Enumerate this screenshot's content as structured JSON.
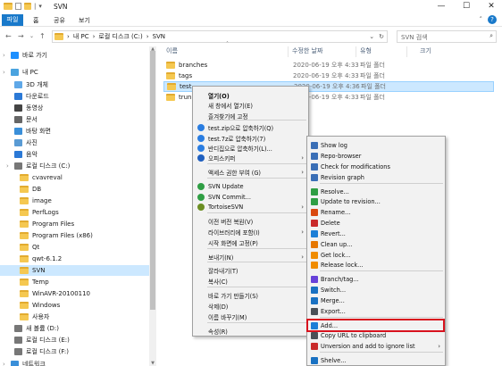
{
  "window": {
    "title": "SVN",
    "qat_sep": "|",
    "qat_arrow": "▾",
    "minimize": "—",
    "maximize": "☐",
    "close": "✕"
  },
  "ribbon": {
    "tabs": [
      "파일",
      "홈",
      "공유",
      "보기"
    ],
    "help_icon": "?",
    "collapse_icon": "˄"
  },
  "nav": {
    "back": "←",
    "forward": "→",
    "dropdown": "⌄",
    "up": "↑"
  },
  "address": {
    "parts": [
      "내 PC",
      "로컬 디스크 (C:)",
      "SVN"
    ],
    "sep": "›",
    "lead_sep": "›",
    "dropdown": "⌄",
    "refresh": "↻"
  },
  "search": {
    "placeholder": "SVN 검색",
    "icon": "⌕"
  },
  "sidebar": {
    "items": [
      {
        "label": "바로 가기",
        "icon": "star-icon",
        "color": "#1e90ff"
      },
      {
        "label": "내 PC",
        "icon": "pc-icon",
        "color": "#4aa3df"
      },
      {
        "label": "3D 개체",
        "icon": "cube-icon",
        "color": "#5fa8e8"
      },
      {
        "label": "다운로드",
        "icon": "download-icon",
        "color": "#2b79d6"
      },
      {
        "label": "동영상",
        "icon": "video-icon",
        "color": "#444"
      },
      {
        "label": "문서",
        "icon": "document-icon",
        "color": "#666"
      },
      {
        "label": "바탕 화면",
        "icon": "desktop-icon",
        "color": "#3a8fd9"
      },
      {
        "label": "사진",
        "icon": "picture-icon",
        "color": "#5a9bd4"
      },
      {
        "label": "음악",
        "icon": "music-icon",
        "color": "#2b79d6"
      },
      {
        "label": "로컬 디스크 (C:)",
        "icon": "drive-icon",
        "color": "#777"
      },
      {
        "label": "cvavreval",
        "icon": "folder-icon",
        "color": "#f5c851"
      },
      {
        "label": "DB",
        "icon": "folder-icon",
        "color": "#f5c851"
      },
      {
        "label": "image",
        "icon": "folder-icon",
        "color": "#f5c851"
      },
      {
        "label": "PerfLogs",
        "icon": "folder-icon",
        "color": "#f5c851"
      },
      {
        "label": "Program Files",
        "icon": "folder-icon",
        "color": "#f5c851"
      },
      {
        "label": "Program Files (x86)",
        "icon": "folder-icon",
        "color": "#f5c851"
      },
      {
        "label": "Qt",
        "icon": "folder-icon",
        "color": "#f5c851"
      },
      {
        "label": "qwt-6.1.2",
        "icon": "folder-icon",
        "color": "#f5c851"
      },
      {
        "label": "SVN",
        "icon": "folder-icon",
        "color": "#f5c851"
      },
      {
        "label": "Temp",
        "icon": "folder-icon",
        "color": "#f5c851"
      },
      {
        "label": "WinAVR-20100110",
        "icon": "folder-icon",
        "color": "#f5c851"
      },
      {
        "label": "Windows",
        "icon": "folder-icon",
        "color": "#f5c851"
      },
      {
        "label": "사용자",
        "icon": "folder-icon",
        "color": "#f5c851"
      },
      {
        "label": "새 볼륨 (D:)",
        "icon": "drive-icon",
        "color": "#777"
      },
      {
        "label": "로컬 디스크 (E:)",
        "icon": "drive-icon",
        "color": "#777"
      },
      {
        "label": "로컬 디스크 (F:)",
        "icon": "drive-icon",
        "color": "#777"
      },
      {
        "label": "네트워크",
        "icon": "network-icon",
        "color": "#3a8fd9"
      }
    ],
    "chevron": "›",
    "scroll_up": "▲",
    "scroll_down": "▼"
  },
  "columns": {
    "name": "이름",
    "date": "수정한 날짜",
    "type": "유형",
    "size": "크기",
    "sort": "˄"
  },
  "files": [
    {
      "name": "branches",
      "date": "2020-06-19 오후 4:33",
      "type": "파일 폴더"
    },
    {
      "name": "tags",
      "date": "2020-06-19 오후 4:33",
      "type": "파일 폴더"
    },
    {
      "name": "test",
      "date": "2020-06-19 오후 4:36",
      "type": "파일 폴더"
    },
    {
      "name": "trunk",
      "date": "2020-06-19 오후 4:33",
      "type": "파일 폴더"
    }
  ],
  "context_menu": {
    "items": [
      {
        "label": "열기(O)",
        "bold": true
      },
      {
        "label": "새 창에서 열기(E)"
      },
      {
        "label": "즐겨찾기에 고정"
      },
      {
        "label": "test.zip으로 압축하기(Q)",
        "icon": "bandizip-icon",
        "color": "#2a7de1"
      },
      {
        "label": "test.7z로 압축하기(7)",
        "icon": "bandizip-icon",
        "color": "#2a7de1"
      },
      {
        "label": "반디집으로 압축하기(L)...",
        "icon": "bandizip-icon",
        "color": "#2a7de1"
      },
      {
        "label": "오피스키퍼",
        "icon": "officekeeper-icon",
        "color": "#1f5fbf",
        "arrow": true
      },
      {
        "label": "액세스 권한 부여 (G)",
        "arrow": true
      },
      {
        "label": "SVN Update",
        "icon": "svn-update-icon",
        "color": "#2f9e44"
      },
      {
        "label": "SVN Commit...",
        "icon": "svn-commit-icon",
        "color": "#2f9e44"
      },
      {
        "label": "TortoiseSVN",
        "icon": "tortoisesvn-icon",
        "color": "#6b8e23",
        "arrow": true
      },
      {
        "label": "이전 버전 복원(V)"
      },
      {
        "label": "라이브러리에 포함(I)",
        "arrow": true
      },
      {
        "label": "시작 화면에 고정(P)"
      },
      {
        "label": "보내기(N)",
        "arrow": true
      },
      {
        "label": "잘라내기(T)"
      },
      {
        "label": "복사(C)"
      },
      {
        "label": "바로 가기 만들기(S)"
      },
      {
        "label": "삭제(D)"
      },
      {
        "label": "이름 바꾸기(M)"
      },
      {
        "label": "속성(R)"
      }
    ],
    "arrow_glyph": "›"
  },
  "svn_menu": {
    "items": [
      {
        "label": "Show log",
        "icon": "log-icon",
        "color": "#3b6fb6"
      },
      {
        "label": "Repo-browser",
        "icon": "repo-browser-icon",
        "color": "#3b6fb6"
      },
      {
        "label": "Check for modifications",
        "icon": "check-modifications-icon",
        "color": "#3b6fb6"
      },
      {
        "label": "Revision graph",
        "icon": "revision-graph-icon",
        "color": "#3b6fb6"
      },
      {
        "label": "Resolve...",
        "icon": "resolve-icon",
        "color": "#2f9e44"
      },
      {
        "label": "Update to revision...",
        "icon": "update-icon",
        "color": "#2f9e44"
      },
      {
        "label": "Rename...",
        "icon": "rename-icon",
        "color": "#d9480f"
      },
      {
        "label": "Delete",
        "icon": "delete-icon",
        "color": "#c92a2a"
      },
      {
        "label": "Revert...",
        "icon": "revert-icon",
        "color": "#1c7ed6"
      },
      {
        "label": "Clean up...",
        "icon": "cleanup-icon",
        "color": "#e67700"
      },
      {
        "label": "Get lock...",
        "icon": "lock-icon",
        "color": "#f08c00"
      },
      {
        "label": "Release lock...",
        "icon": "unlock-icon",
        "color": "#f08c00"
      },
      {
        "label": "Branch/tag...",
        "icon": "branch-icon",
        "color": "#6741d9"
      },
      {
        "label": "Switch...",
        "icon": "switch-icon",
        "color": "#1971c2"
      },
      {
        "label": "Merge...",
        "icon": "merge-icon",
        "color": "#1971c2"
      },
      {
        "label": "Export...",
        "icon": "export-icon",
        "color": "#495057"
      },
      {
        "label": "Add...",
        "icon": "add-icon",
        "color": "#1c7ed6",
        "highlighted": true
      },
      {
        "label": "Copy URL to clipboard",
        "icon": "copy-url-icon",
        "color": "#495057"
      },
      {
        "label": "Unversion and add to ignore list",
        "icon": "ignore-icon",
        "color": "#c92a2a",
        "arrow": true
      },
      {
        "label": "Shelve...",
        "icon": "shelve-icon",
        "color": "#1971c2"
      }
    ],
    "highlight_color": "#d8121e"
  }
}
